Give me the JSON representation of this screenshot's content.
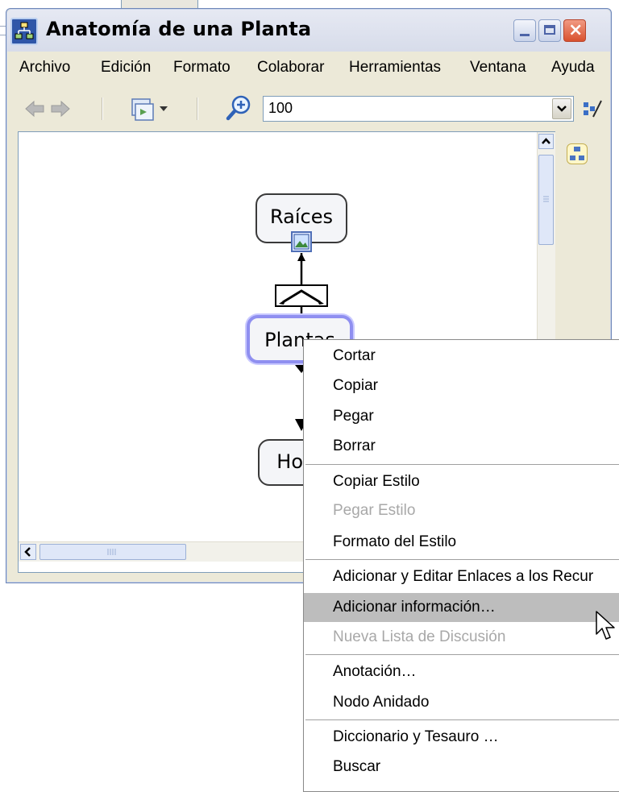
{
  "window": {
    "title": "Anatomía de una Planta"
  },
  "menubar": {
    "items": [
      "Archivo",
      "Edición",
      "Formato",
      "Colaborar",
      "Herramientas",
      "Ventana",
      "Ayuda"
    ]
  },
  "toolbar": {
    "zoom_value": "100"
  },
  "concept_map": {
    "nodes": {
      "raices": "Raíces",
      "plantas": "Plantas",
      "hojas": "Ho"
    }
  },
  "context_menu": {
    "items": [
      {
        "label": "Cortar",
        "enabled": true
      },
      {
        "label": "Copiar",
        "enabled": true
      },
      {
        "label": "Pegar",
        "enabled": true
      },
      {
        "label": "Borrar",
        "enabled": true
      },
      {
        "label": "Copiar Estilo",
        "enabled": true
      },
      {
        "label": "Pegar Estilo",
        "enabled": false
      },
      {
        "label": "Formato del Estilo",
        "enabled": true
      },
      {
        "label": "Adicionar y Editar Enlaces a los Recur",
        "enabled": true
      },
      {
        "label": "Adicionar información…",
        "enabled": true,
        "highlighted": true
      },
      {
        "label": "Nueva Lista de Discusión",
        "enabled": false
      },
      {
        "label": "Anotación…",
        "enabled": true
      },
      {
        "label": "Nodo Anidado",
        "enabled": true
      },
      {
        "label": "Diccionario y Tesauro …",
        "enabled": true
      },
      {
        "label": "Buscar",
        "enabled": true
      }
    ]
  },
  "colors": {
    "titlebar": "#dfe3ef",
    "highlight": "#bdbdbd",
    "selected_node_border": "#8f8ff0"
  }
}
